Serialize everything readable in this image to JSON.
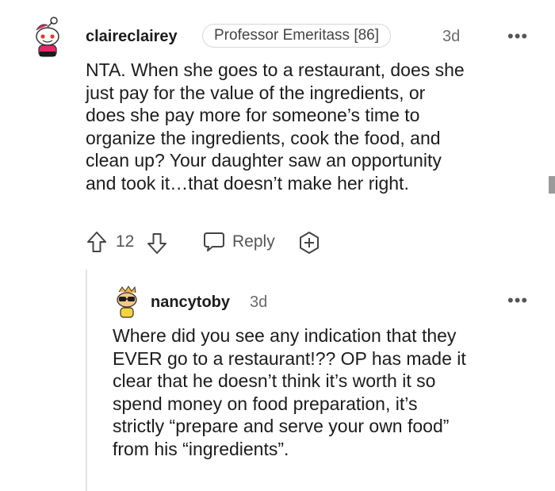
{
  "comment": {
    "username": "claireclairey",
    "flair": "Professor Emeritass [86]",
    "age": "3d",
    "more": "•••",
    "lines": [
      "NTA. When she goes to a restaurant, does she",
      "just pay for the value of the ingredients, or",
      "does she pay more for someone’s time to",
      "organize the ingredients, cook the food, and",
      "clean up? Your daughter saw an opportunity",
      "and took it…that doesn’t make her right."
    ],
    "vote_count": "12",
    "reply_label": "Reply"
  },
  "reply": {
    "username": "nancytoby",
    "age": "3d",
    "more": "•••",
    "lines": [
      "Where did you see any indication that they",
      "EVER go to a restaurant!?? OP has made it",
      "clear that he doesn’t think it’s worth it so",
      "spend money on food preparation, it’s",
      "strictly “prepare and serve your own food”",
      "from his “ingredients”."
    ]
  },
  "icons": {
    "upvote": "upvote-arrow-icon",
    "downvote": "downvote-arrow-icon",
    "reply": "speech-bubble-icon",
    "award": "plus-award-icon",
    "avatar1": "snoo-avatar-icon",
    "avatar2": "snoo-avatar-icon"
  }
}
